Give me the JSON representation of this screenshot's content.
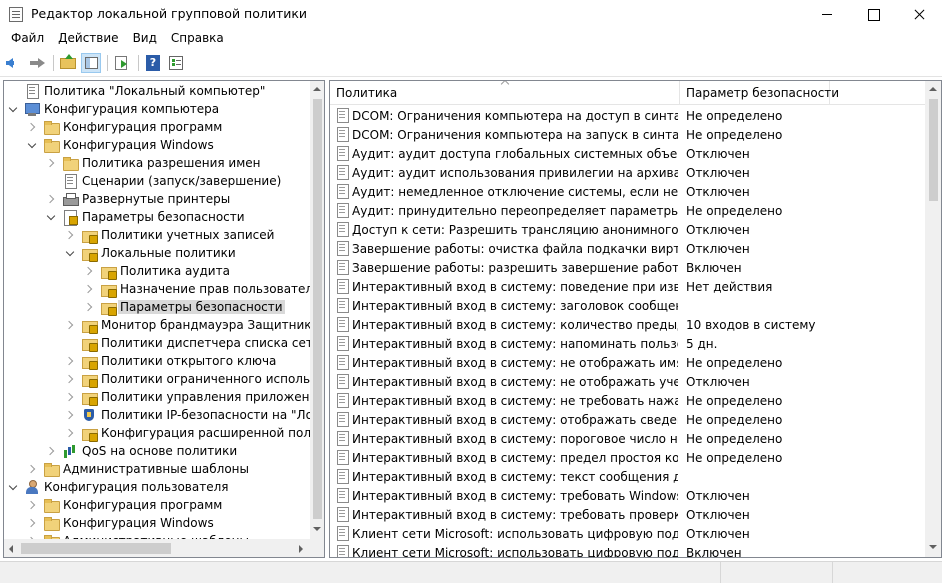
{
  "window": {
    "title": "Редактор локальной групповой политики"
  },
  "menu": [
    "Файл",
    "Действие",
    "Вид",
    "Справка"
  ],
  "toolbar": {
    "back_icon": "back-arrow-icon",
    "forward_icon": "forward-arrow-icon",
    "help_glyph": "?"
  },
  "tree": [
    {
      "label": "Политика \"Локальный компьютер\"",
      "level": 0,
      "expander": "none",
      "icon": "i-doc"
    },
    {
      "label": "Конфигурация компьютера",
      "level": 0,
      "expander": "open",
      "icon": "i-computer"
    },
    {
      "label": "Конфигурация программ",
      "level": 1,
      "expander": "closed",
      "icon": "i-folder"
    },
    {
      "label": "Конфигурация Windows",
      "level": 1,
      "expander": "open",
      "icon": "i-folder"
    },
    {
      "label": "Политика разрешения имен",
      "level": 2,
      "expander": "closed",
      "icon": "i-folder"
    },
    {
      "label": "Сценарии (запуск/завершение)",
      "level": 2,
      "expander": "none",
      "icon": "i-doc"
    },
    {
      "label": "Развернутые принтеры",
      "level": 2,
      "expander": "closed",
      "icon": "i-printer"
    },
    {
      "label": "Параметры безопасности",
      "level": 2,
      "expander": "open",
      "icon": "i-secdoc"
    },
    {
      "label": "Политики учетных записей",
      "level": 3,
      "expander": "closed",
      "icon": "i-lockfolder"
    },
    {
      "label": "Локальные политики",
      "level": 3,
      "expander": "open",
      "icon": "i-lockfolder"
    },
    {
      "label": "Политика аудита",
      "level": 4,
      "expander": "closed",
      "icon": "i-lockfolder"
    },
    {
      "label": "Назначение прав пользователя",
      "level": 4,
      "expander": "closed",
      "icon": "i-lockfolder"
    },
    {
      "label": "Параметры безопасности",
      "level": 4,
      "expander": "closed",
      "icon": "i-lockfolder",
      "selected": true
    },
    {
      "label": "Монитор брандмауэра Защитника W",
      "level": 3,
      "expander": "closed",
      "icon": "i-lockfolder"
    },
    {
      "label": "Политики диспетчера списка сетей",
      "level": 3,
      "expander": "none",
      "icon": "i-lockfolder"
    },
    {
      "label": "Политики открытого ключа",
      "level": 3,
      "expander": "closed",
      "icon": "i-lockfolder"
    },
    {
      "label": "Политики ограниченного использова",
      "level": 3,
      "expander": "closed",
      "icon": "i-lockfolder"
    },
    {
      "label": "Политики управления приложениям",
      "level": 3,
      "expander": "closed",
      "icon": "i-lockfolder"
    },
    {
      "label": "Политики IP-безопасности на \"Локал",
      "level": 3,
      "expander": "closed",
      "icon": "i-shield"
    },
    {
      "label": "Конфигурация расширенной полити",
      "level": 3,
      "expander": "closed",
      "icon": "i-lockfolder"
    },
    {
      "label": "QoS на основе политики",
      "level": 2,
      "expander": "closed",
      "icon": "i-chart"
    },
    {
      "label": "Административные шаблоны",
      "level": 1,
      "expander": "closed",
      "icon": "i-folder"
    },
    {
      "label": "Конфигурация пользователя",
      "level": 0,
      "expander": "open",
      "icon": "i-user"
    },
    {
      "label": "Конфигурация программ",
      "level": 1,
      "expander": "closed",
      "icon": "i-folder"
    },
    {
      "label": "Конфигурация Windows",
      "level": 1,
      "expander": "closed",
      "icon": "i-folder"
    },
    {
      "label": "Административные шаблоны",
      "level": 1,
      "expander": "closed",
      "icon": "i-folder"
    }
  ],
  "list": {
    "columns": {
      "policy": "Политика",
      "setting": "Параметр безопасности"
    },
    "rows": [
      {
        "policy": "DCOM: Ограничения компьютера на доступ в синтаксисе...",
        "setting": "Не определено"
      },
      {
        "policy": "DCOM: Ограничения компьютера на запуск в синтаксисе...",
        "setting": "Не определено"
      },
      {
        "policy": "Аудит: аудит доступа глобальных системных объектов",
        "setting": "Отключен"
      },
      {
        "policy": "Аудит: аудит использования привилегии на архивацию и...",
        "setting": "Отключен"
      },
      {
        "policy": "Аудит: немедленное отключение системы, если невозмо...",
        "setting": "Отключен"
      },
      {
        "policy": "Аудит: принудительно переопределяет параметры катег...",
        "setting": "Не определено"
      },
      {
        "policy": "Доступ к сети: Разрешить трансляцию анонимного SID в ...",
        "setting": "Отключен"
      },
      {
        "policy": "Завершение работы: очистка файла подкачки виртуальн...",
        "setting": "Отключен"
      },
      {
        "policy": "Завершение работы: разрешить завершение работы сис...",
        "setting": "Включен"
      },
      {
        "policy": "Интерактивный вход в систему:  поведение при извлечен...",
        "setting": "Нет действия"
      },
      {
        "policy": "Интерактивный вход в систему: заголовок сообщения дл...",
        "setting": ""
      },
      {
        "policy": "Интерактивный вход в систему: количество предыдущих...",
        "setting": "10 входов в систему"
      },
      {
        "policy": "Интерактивный вход в систему: напоминать пользовател...",
        "setting": "5 дн."
      },
      {
        "policy": "Интерактивный вход в систему: не отображать имя польз...",
        "setting": "Не определено"
      },
      {
        "policy": "Интерактивный вход в систему: не отображать учетные д...",
        "setting": "Отключен"
      },
      {
        "policy": "Интерактивный вход в систему: не требовать нажатия CT...",
        "setting": "Не определено"
      },
      {
        "policy": "Интерактивный вход в систему: отображать сведения о п...",
        "setting": "Не определено"
      },
      {
        "policy": "Интерактивный вход в систему: пороговое число неудач...",
        "setting": "Не определено"
      },
      {
        "policy": "Интерактивный вход в систему: предел простоя компью...",
        "setting": "Не определено"
      },
      {
        "policy": "Интерактивный вход в систему: текст сообщения для по...",
        "setting": ""
      },
      {
        "policy": "Интерактивный вход в систему: требовать Windows Hello...",
        "setting": "Отключен"
      },
      {
        "policy": "Интерактивный вход в систему: требовать проверки на к...",
        "setting": "Отключен"
      },
      {
        "policy": "Клиент сети Microsoft: использовать цифровую подпись ...",
        "setting": "Отключен"
      },
      {
        "policy": "Клиент сети Microsoft: использовать цифровую подпись ...",
        "setting": "Включен"
      }
    ]
  }
}
